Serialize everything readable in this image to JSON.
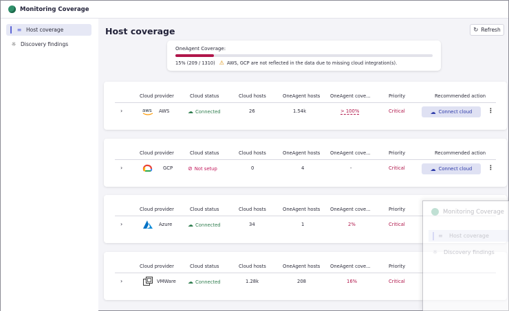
{
  "app": {
    "title": "Monitoring Coverage"
  },
  "sidebar": {
    "items": [
      {
        "label": "Host coverage",
        "icon": "host-icon",
        "active": true
      },
      {
        "label": "Discovery findings",
        "icon": "lightbulb-icon",
        "active": false
      }
    ]
  },
  "main": {
    "title": "Host coverage",
    "refresh_label": "Refresh",
    "coverage": {
      "label": "OneAgent Coverage:",
      "percent": 15,
      "summary": "15%  (209 / 1310)",
      "warning": "AWS, GCP are not reflected in the data due to missing cloud integration(s)."
    },
    "table_headers": {
      "provider": "Cloud provider",
      "status": "Cloud status",
      "hosts": "Cloud hosts",
      "oa_hosts": "OneAgent hosts",
      "oa_cov": "OneAgent cove...",
      "priority": "Priority",
      "action": "Recommended action"
    },
    "providers": [
      {
        "name": "AWS",
        "logo_text": "aws",
        "status": "Connected",
        "status_ok": true,
        "hosts": "26",
        "oa_hosts": "1.54k",
        "oa_cov": "> 100%",
        "priority": "Critical",
        "action": "Connect cloud"
      },
      {
        "name": "GCP",
        "status": "Not setup",
        "status_ok": false,
        "hosts": "0",
        "oa_hosts": "4",
        "oa_cov": "-",
        "priority": "Critical",
        "action": "Connect cloud"
      },
      {
        "name": "Azure",
        "status": "Connected",
        "status_ok": true,
        "hosts": "34",
        "oa_hosts": "1",
        "oa_cov": "2%",
        "priority": "Critical",
        "action": ""
      },
      {
        "name": "VMWare",
        "status": "Connected",
        "status_ok": true,
        "hosts": "1.28k",
        "oa_hosts": "208",
        "oa_cov": "16%",
        "priority": "Critical",
        "action": ""
      }
    ]
  },
  "overlay": {
    "title": "Monitoring Coverage",
    "items": [
      {
        "label": "Host coverage"
      },
      {
        "label": "Discovery findings"
      }
    ]
  },
  "colors": {
    "accent": "#5b64d6",
    "critical": "#b0164a",
    "connected": "#2f7d4e",
    "button_bg": "#dfe1f3"
  }
}
